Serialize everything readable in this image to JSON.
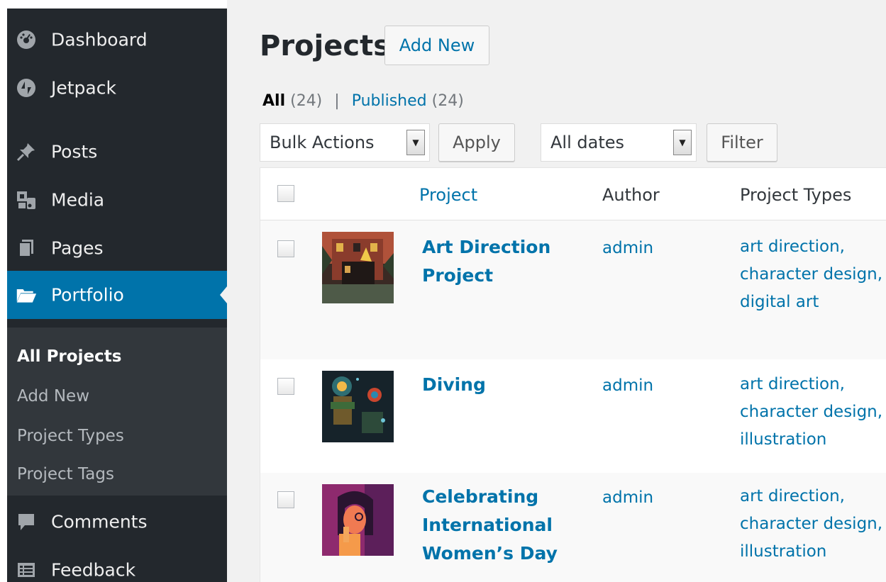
{
  "sidebar": {
    "items": [
      {
        "label": "Dashboard",
        "icon": "dashboard-icon"
      },
      {
        "label": "Jetpack",
        "icon": "jetpack-icon"
      },
      {
        "label": "Posts",
        "icon": "pin-icon"
      },
      {
        "label": "Media",
        "icon": "media-icon"
      },
      {
        "label": "Pages",
        "icon": "pages-icon"
      },
      {
        "label": "Portfolio",
        "icon": "folder-icon"
      },
      {
        "label": "Comments",
        "icon": "comment-icon"
      },
      {
        "label": "Feedback",
        "icon": "feedback-icon"
      }
    ],
    "submenu": [
      "All Projects",
      "Add New",
      "Project Types",
      "Project Tags"
    ],
    "colors": {
      "bg": "#23282d",
      "active": "#0073aa",
      "submenu_bg": "#32373c"
    }
  },
  "page": {
    "title": "Projects",
    "add_new": "Add New"
  },
  "filters": {
    "all_label": "All",
    "all_count": "(24)",
    "separator": "|",
    "published_label": "Published",
    "published_count": "(24)",
    "bulk_actions": "Bulk Actions",
    "apply": "Apply",
    "all_dates": "All dates",
    "filter": "Filter"
  },
  "table": {
    "columns": [
      "Project",
      "Author",
      "Project Types"
    ],
    "rows": [
      {
        "title_lines": [
          "Art Direction",
          "Project"
        ],
        "author": "admin",
        "types": [
          "art direction,",
          "character design,",
          "digital art"
        ]
      },
      {
        "title_lines": [
          "Diving"
        ],
        "author": "admin",
        "types": [
          "art direction,",
          "character design,",
          "illustration"
        ]
      },
      {
        "title_lines": [
          "Celebrating",
          "International",
          "Women’s Day"
        ],
        "author": "admin",
        "types": [
          "art direction,",
          "character design,",
          "illustration"
        ]
      }
    ]
  },
  "colors": {
    "link": "#0073aa",
    "main_bg": "#f1f1f1"
  }
}
